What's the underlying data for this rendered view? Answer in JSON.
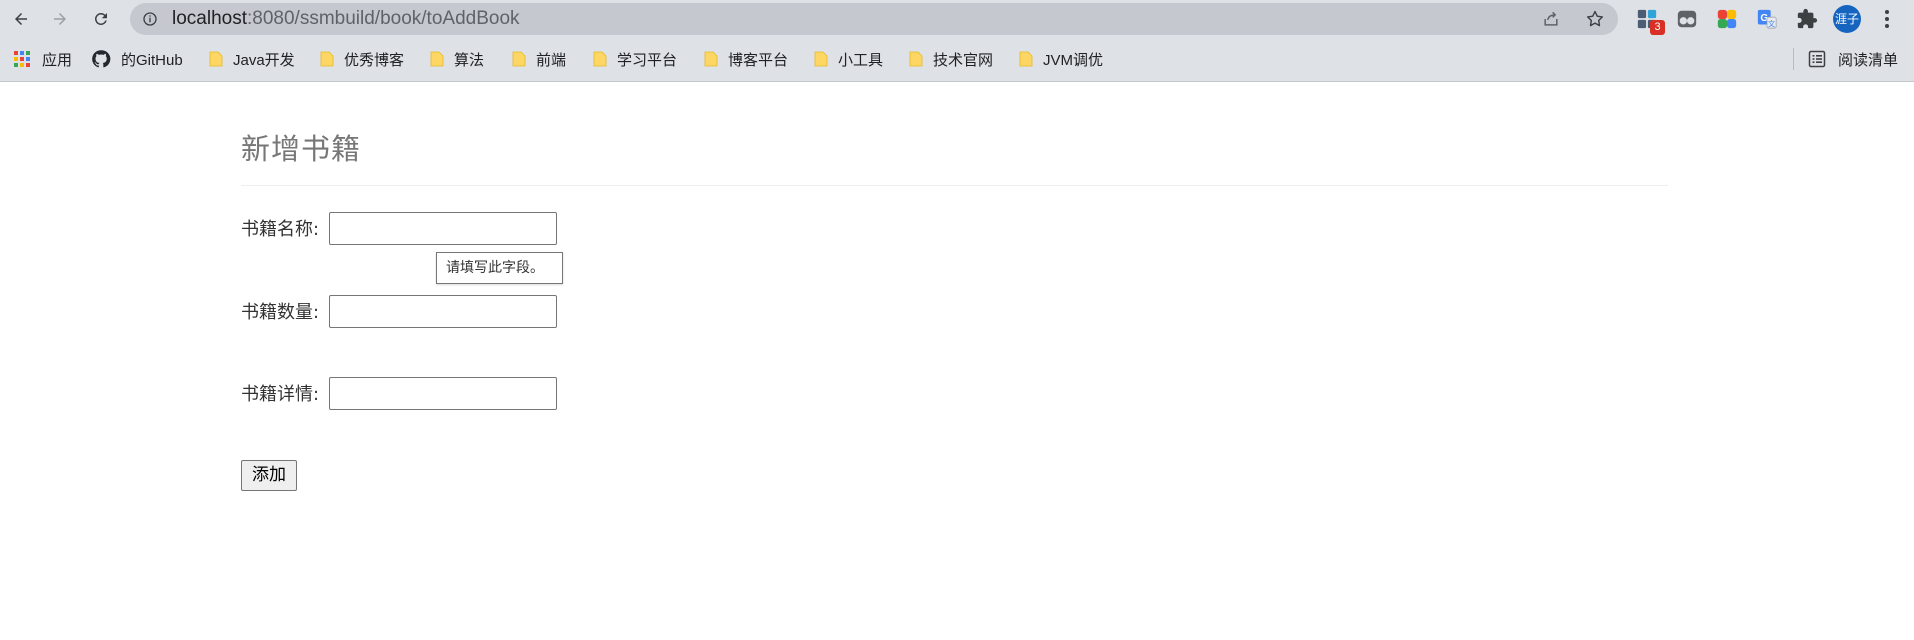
{
  "browser": {
    "url_host": "localhost",
    "url_path": ":8080/ssmbuild/book/toAddBook",
    "extension_badge": "3",
    "profile_initials": "涯子"
  },
  "bookmarks": {
    "items": [
      {
        "label": "应用",
        "icon": "apps-grid-icon"
      },
      {
        "label": "的GitHub",
        "icon": "github-icon"
      },
      {
        "label": "Java开发",
        "icon": "folder-icon"
      },
      {
        "label": "优秀博客",
        "icon": "folder-icon"
      },
      {
        "label": "算法",
        "icon": "folder-icon"
      },
      {
        "label": "前端",
        "icon": "folder-icon"
      },
      {
        "label": "学习平台",
        "icon": "folder-icon"
      },
      {
        "label": "博客平台",
        "icon": "folder-icon"
      },
      {
        "label": "小工具",
        "icon": "folder-icon"
      },
      {
        "label": "技术官网",
        "icon": "folder-icon"
      },
      {
        "label": "JVM调优",
        "icon": "folder-icon"
      }
    ],
    "reading_list": "阅读清单"
  },
  "page": {
    "title": "新增书籍",
    "fields": [
      {
        "label": "书籍名称:",
        "value": ""
      },
      {
        "label": "书籍数量:",
        "value": ""
      },
      {
        "label": "书籍详情:",
        "value": ""
      }
    ],
    "validation_tooltip": "请填写此字段。",
    "submit_label": "添加"
  },
  "colors": {
    "toolbar_bg": "#dee1e6",
    "omnibox_bg": "#c6c8cf",
    "folder_yellow": "#fdd663",
    "avatar_blue": "#1565c0"
  }
}
